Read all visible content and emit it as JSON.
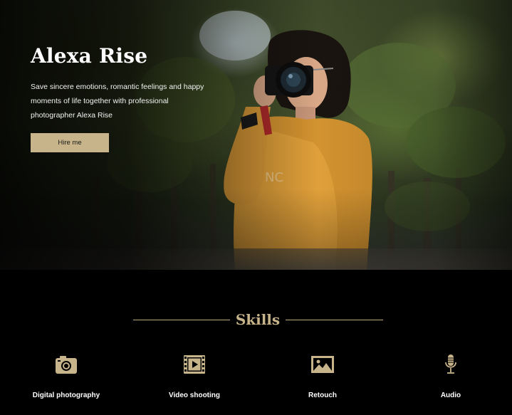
{
  "hero": {
    "title": "Alexa Rise",
    "description": "Save sincere emotions, romantic feelings and happy moments of life together with professional photographer Alexa Rise",
    "cta_label": "Hire me"
  },
  "skills": {
    "heading": "Skills",
    "items": [
      {
        "label": "Digital photography",
        "icon": "camera-icon"
      },
      {
        "label": "Video shooting",
        "icon": "film-play-icon"
      },
      {
        "label": "Retouch",
        "icon": "image-icon"
      },
      {
        "label": "Audio",
        "icon": "microphone-icon"
      }
    ]
  },
  "colors": {
    "accent": "#c8b48a",
    "background": "#000000",
    "text": "#ffffff"
  }
}
